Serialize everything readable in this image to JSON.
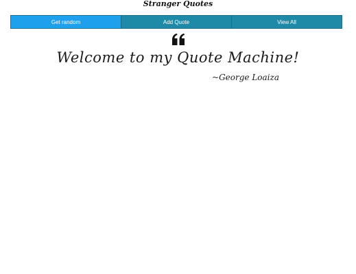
{
  "header": {
    "title": "Stranger Quotes"
  },
  "nav": {
    "items": [
      {
        "label": "Get random",
        "active": true
      },
      {
        "label": "Add Quote",
        "active": false
      },
      {
        "label": "View All",
        "active": false
      }
    ],
    "active_color": "#1fa0ec",
    "inactive_color": "#1f8aa8"
  },
  "quote": {
    "icon": "quote-left-icon",
    "text": "Welcome to my Quote Machine!",
    "author": "~George Loaiza"
  }
}
